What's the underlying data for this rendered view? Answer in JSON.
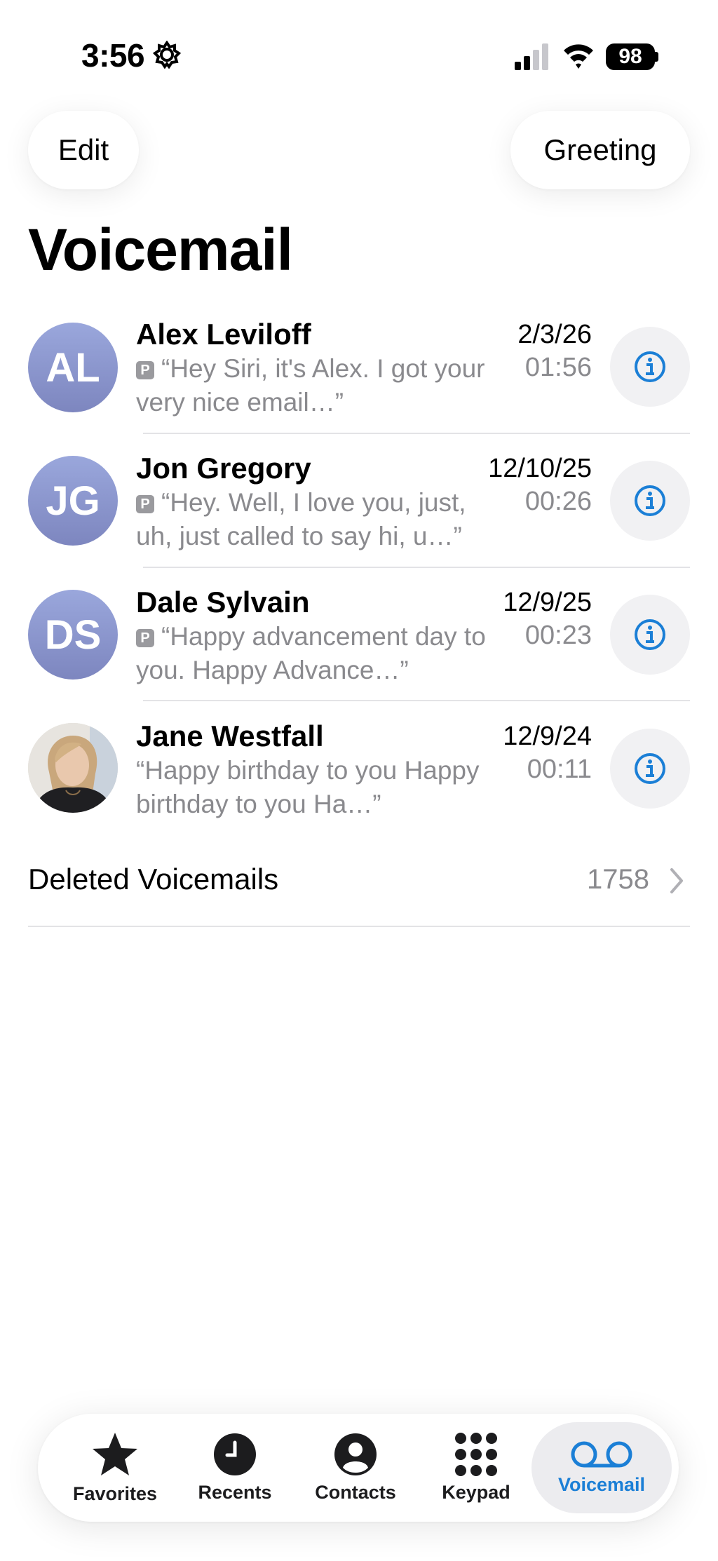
{
  "status_bar": {
    "time": "3:56",
    "battery": "98"
  },
  "header": {
    "edit_label": "Edit",
    "greeting_label": "Greeting",
    "title": "Voicemail"
  },
  "voicemails": [
    {
      "initials": "AL",
      "name": "Alex Leviloff",
      "date": "2/3/26",
      "duration": "01:56",
      "preview": "“Hey Siri, it's Alex.  I got your very nice email…”",
      "badge": "P"
    },
    {
      "initials": "JG",
      "name": "Jon  Gregory",
      "date": "12/10/25",
      "duration": "00:26",
      "preview": "“Hey.  Well, I love you, just, uh, just called to say hi, u…”",
      "badge": "P"
    },
    {
      "initials": "DS",
      "name": "Dale Sylvain",
      "date": "12/9/25",
      "duration": "00:23",
      "preview": "“Happy advancement day to you.  Happy Advance…”",
      "badge": "P"
    },
    {
      "initials": "",
      "name": "Jane Westfall",
      "date": "12/9/24",
      "duration": "00:11",
      "preview": "“Happy birthday to you Happy birthday to you Ha…”",
      "badge": ""
    }
  ],
  "deleted": {
    "label": "Deleted Voicemails",
    "count": "1758"
  },
  "tabs": [
    {
      "label": "Favorites",
      "icon": "star-icon"
    },
    {
      "label": "Recents",
      "icon": "clock-icon"
    },
    {
      "label": "Contacts",
      "icon": "person-icon"
    },
    {
      "label": "Keypad",
      "icon": "keypad-icon"
    },
    {
      "label": "Voicemail",
      "icon": "voicemail-icon",
      "active": true
    }
  ],
  "colors": {
    "accent": "#1b7fd6",
    "secondary_text": "#8a8a8e",
    "avatar": "#8a94cf"
  }
}
